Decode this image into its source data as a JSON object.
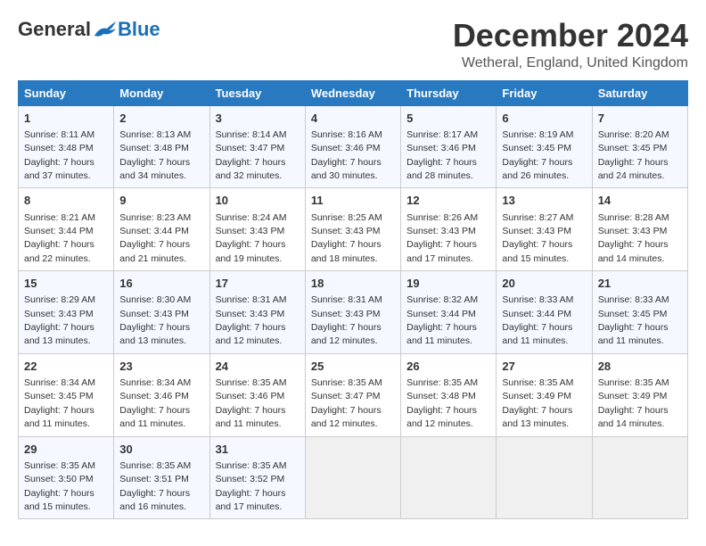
{
  "logo": {
    "general": "General",
    "blue": "Blue"
  },
  "title": "December 2024",
  "location": "Wetheral, England, United Kingdom",
  "days_of_week": [
    "Sunday",
    "Monday",
    "Tuesday",
    "Wednesday",
    "Thursday",
    "Friday",
    "Saturday"
  ],
  "weeks": [
    [
      {
        "day": "1",
        "sunrise": "Sunrise: 8:11 AM",
        "sunset": "Sunset: 3:48 PM",
        "daylight": "Daylight: 7 hours and 37 minutes."
      },
      {
        "day": "2",
        "sunrise": "Sunrise: 8:13 AM",
        "sunset": "Sunset: 3:48 PM",
        "daylight": "Daylight: 7 hours and 34 minutes."
      },
      {
        "day": "3",
        "sunrise": "Sunrise: 8:14 AM",
        "sunset": "Sunset: 3:47 PM",
        "daylight": "Daylight: 7 hours and 32 minutes."
      },
      {
        "day": "4",
        "sunrise": "Sunrise: 8:16 AM",
        "sunset": "Sunset: 3:46 PM",
        "daylight": "Daylight: 7 hours and 30 minutes."
      },
      {
        "day": "5",
        "sunrise": "Sunrise: 8:17 AM",
        "sunset": "Sunset: 3:46 PM",
        "daylight": "Daylight: 7 hours and 28 minutes."
      },
      {
        "day": "6",
        "sunrise": "Sunrise: 8:19 AM",
        "sunset": "Sunset: 3:45 PM",
        "daylight": "Daylight: 7 hours and 26 minutes."
      },
      {
        "day": "7",
        "sunrise": "Sunrise: 8:20 AM",
        "sunset": "Sunset: 3:45 PM",
        "daylight": "Daylight: 7 hours and 24 minutes."
      }
    ],
    [
      {
        "day": "8",
        "sunrise": "Sunrise: 8:21 AM",
        "sunset": "Sunset: 3:44 PM",
        "daylight": "Daylight: 7 hours and 22 minutes."
      },
      {
        "day": "9",
        "sunrise": "Sunrise: 8:23 AM",
        "sunset": "Sunset: 3:44 PM",
        "daylight": "Daylight: 7 hours and 21 minutes."
      },
      {
        "day": "10",
        "sunrise": "Sunrise: 8:24 AM",
        "sunset": "Sunset: 3:43 PM",
        "daylight": "Daylight: 7 hours and 19 minutes."
      },
      {
        "day": "11",
        "sunrise": "Sunrise: 8:25 AM",
        "sunset": "Sunset: 3:43 PM",
        "daylight": "Daylight: 7 hours and 18 minutes."
      },
      {
        "day": "12",
        "sunrise": "Sunrise: 8:26 AM",
        "sunset": "Sunset: 3:43 PM",
        "daylight": "Daylight: 7 hours and 17 minutes."
      },
      {
        "day": "13",
        "sunrise": "Sunrise: 8:27 AM",
        "sunset": "Sunset: 3:43 PM",
        "daylight": "Daylight: 7 hours and 15 minutes."
      },
      {
        "day": "14",
        "sunrise": "Sunrise: 8:28 AM",
        "sunset": "Sunset: 3:43 PM",
        "daylight": "Daylight: 7 hours and 14 minutes."
      }
    ],
    [
      {
        "day": "15",
        "sunrise": "Sunrise: 8:29 AM",
        "sunset": "Sunset: 3:43 PM",
        "daylight": "Daylight: 7 hours and 13 minutes."
      },
      {
        "day": "16",
        "sunrise": "Sunrise: 8:30 AM",
        "sunset": "Sunset: 3:43 PM",
        "daylight": "Daylight: 7 hours and 13 minutes."
      },
      {
        "day": "17",
        "sunrise": "Sunrise: 8:31 AM",
        "sunset": "Sunset: 3:43 PM",
        "daylight": "Daylight: 7 hours and 12 minutes."
      },
      {
        "day": "18",
        "sunrise": "Sunrise: 8:31 AM",
        "sunset": "Sunset: 3:43 PM",
        "daylight": "Daylight: 7 hours and 12 minutes."
      },
      {
        "day": "19",
        "sunrise": "Sunrise: 8:32 AM",
        "sunset": "Sunset: 3:44 PM",
        "daylight": "Daylight: 7 hours and 11 minutes."
      },
      {
        "day": "20",
        "sunrise": "Sunrise: 8:33 AM",
        "sunset": "Sunset: 3:44 PM",
        "daylight": "Daylight: 7 hours and 11 minutes."
      },
      {
        "day": "21",
        "sunrise": "Sunrise: 8:33 AM",
        "sunset": "Sunset: 3:45 PM",
        "daylight": "Daylight: 7 hours and 11 minutes."
      }
    ],
    [
      {
        "day": "22",
        "sunrise": "Sunrise: 8:34 AM",
        "sunset": "Sunset: 3:45 PM",
        "daylight": "Daylight: 7 hours and 11 minutes."
      },
      {
        "day": "23",
        "sunrise": "Sunrise: 8:34 AM",
        "sunset": "Sunset: 3:46 PM",
        "daylight": "Daylight: 7 hours and 11 minutes."
      },
      {
        "day": "24",
        "sunrise": "Sunrise: 8:35 AM",
        "sunset": "Sunset: 3:46 PM",
        "daylight": "Daylight: 7 hours and 11 minutes."
      },
      {
        "day": "25",
        "sunrise": "Sunrise: 8:35 AM",
        "sunset": "Sunset: 3:47 PM",
        "daylight": "Daylight: 7 hours and 12 minutes."
      },
      {
        "day": "26",
        "sunrise": "Sunrise: 8:35 AM",
        "sunset": "Sunset: 3:48 PM",
        "daylight": "Daylight: 7 hours and 12 minutes."
      },
      {
        "day": "27",
        "sunrise": "Sunrise: 8:35 AM",
        "sunset": "Sunset: 3:49 PM",
        "daylight": "Daylight: 7 hours and 13 minutes."
      },
      {
        "day": "28",
        "sunrise": "Sunrise: 8:35 AM",
        "sunset": "Sunset: 3:49 PM",
        "daylight": "Daylight: 7 hours and 14 minutes."
      }
    ],
    [
      {
        "day": "29",
        "sunrise": "Sunrise: 8:35 AM",
        "sunset": "Sunset: 3:50 PM",
        "daylight": "Daylight: 7 hours and 15 minutes."
      },
      {
        "day": "30",
        "sunrise": "Sunrise: 8:35 AM",
        "sunset": "Sunset: 3:51 PM",
        "daylight": "Daylight: 7 hours and 16 minutes."
      },
      {
        "day": "31",
        "sunrise": "Sunrise: 8:35 AM",
        "sunset": "Sunset: 3:52 PM",
        "daylight": "Daylight: 7 hours and 17 minutes."
      },
      null,
      null,
      null,
      null
    ]
  ]
}
